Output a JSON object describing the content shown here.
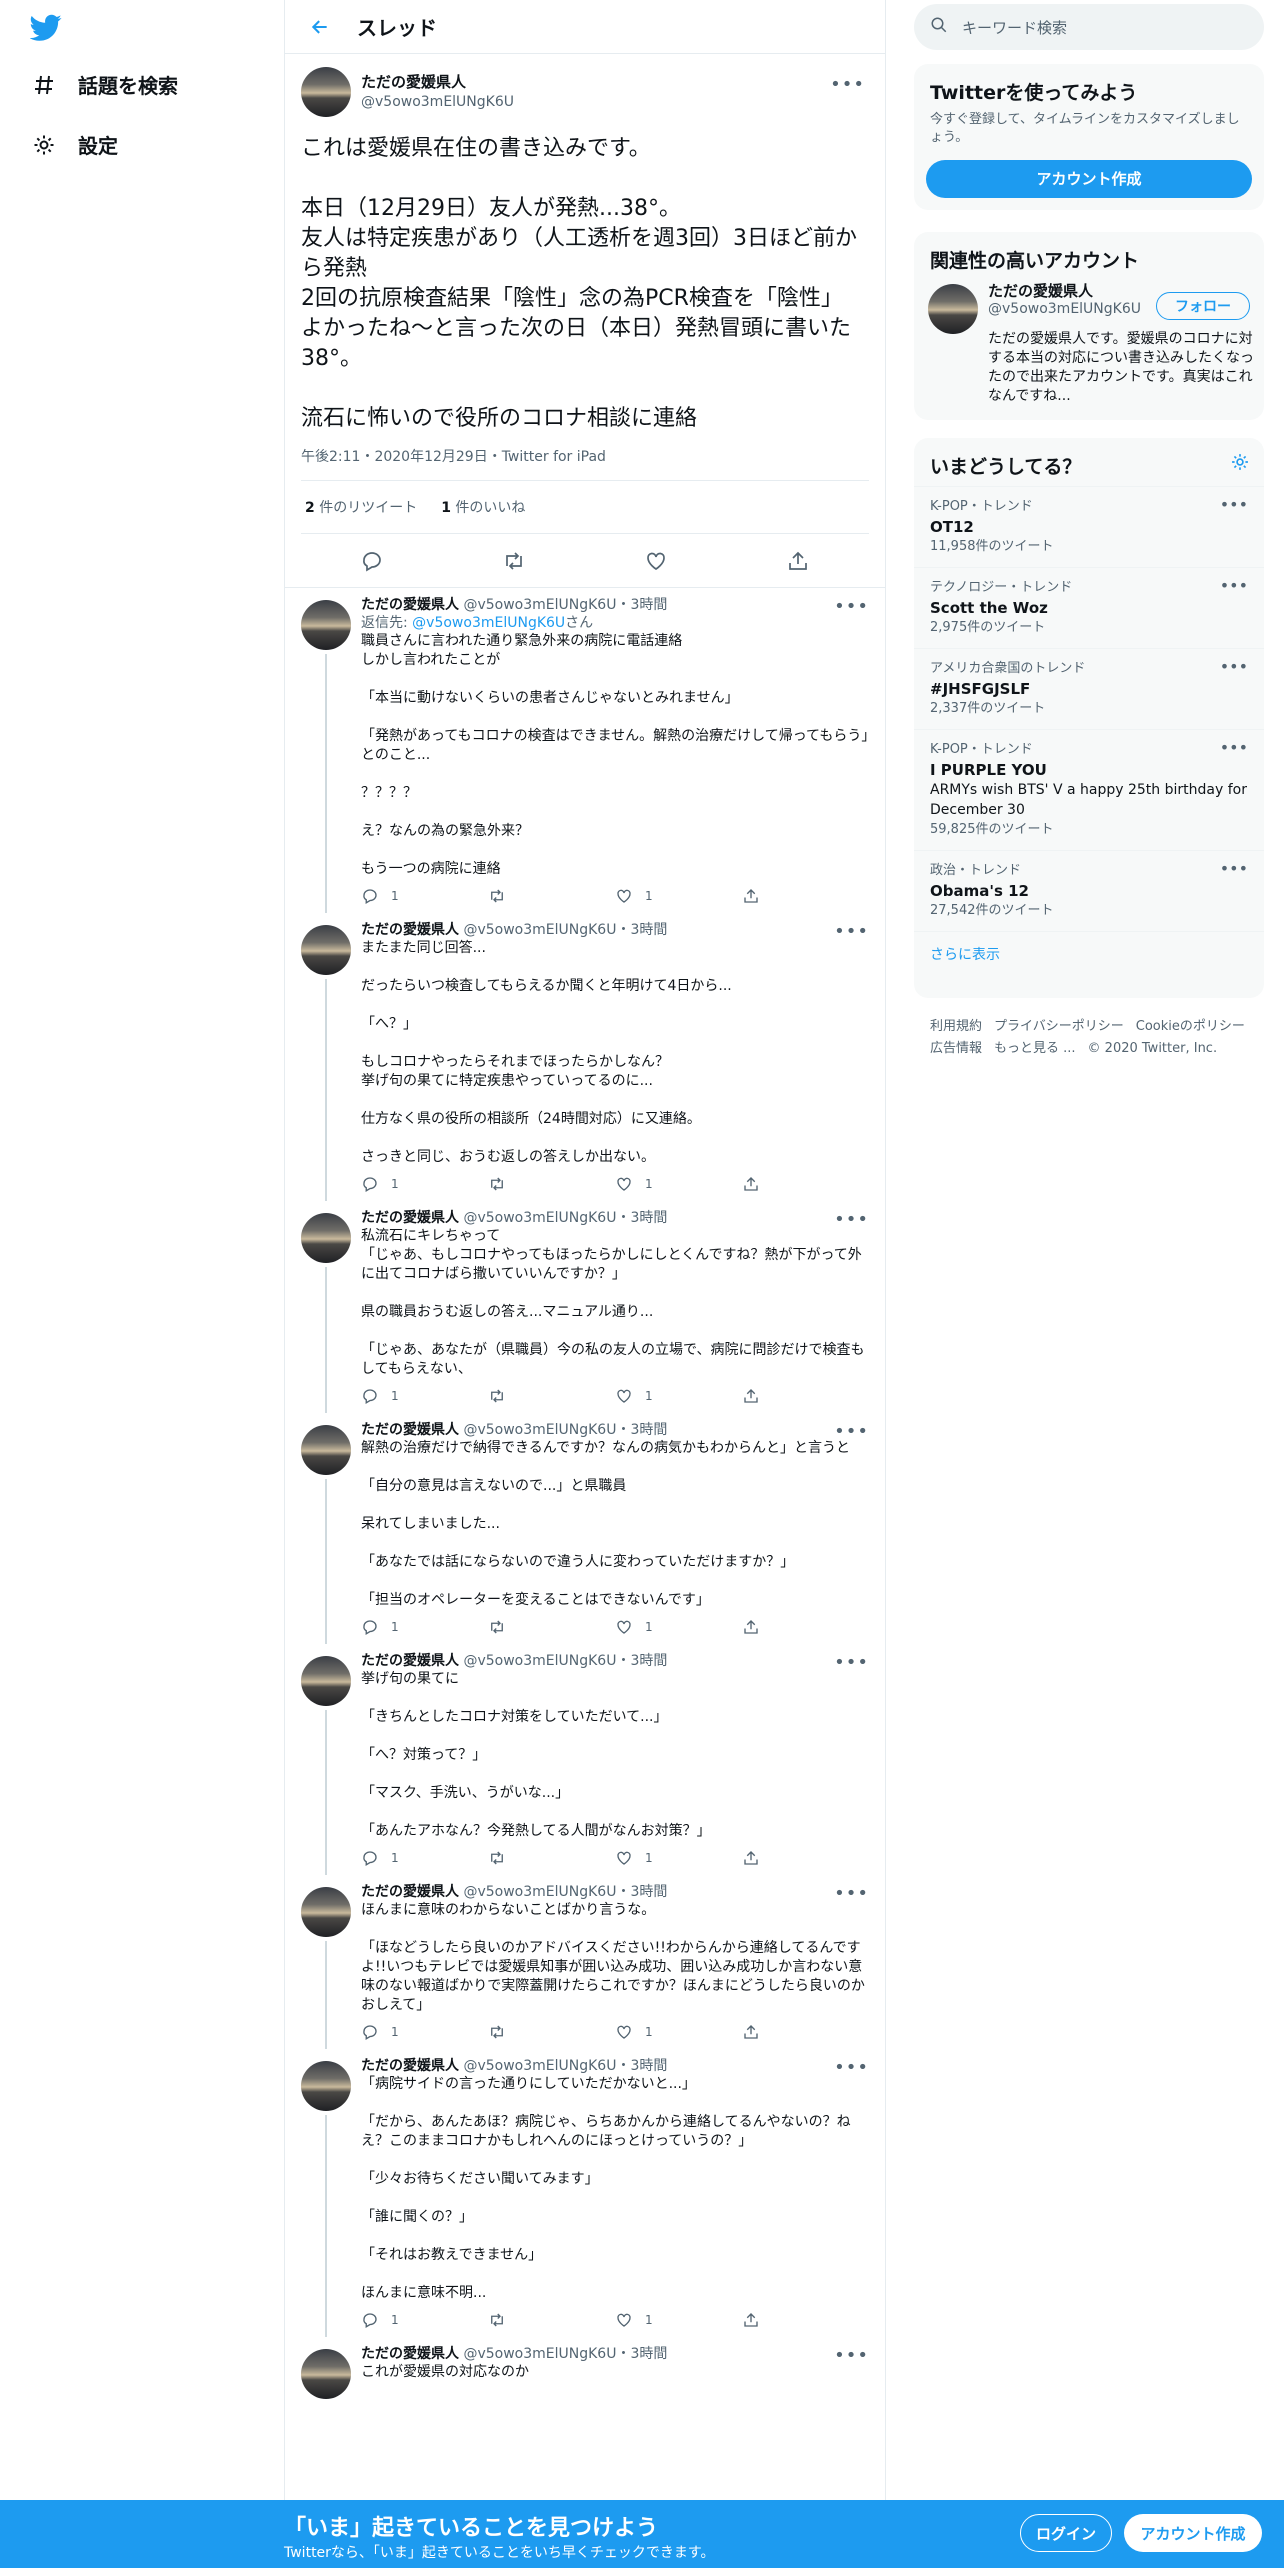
{
  "nav": {
    "explore": "話題を検索",
    "settings": "設定"
  },
  "header": {
    "title": "スレッド"
  },
  "focal": {
    "name": "ただの愛媛県人",
    "handle": "@v5owo3mElUNgK6U",
    "text": "これは愛媛県在住の書き込みです。\n\n本日（12月29日）友人が発熱...38°。\n友人は特定疾患があり（人工透析を週3回）3日ほど前から発熱\n2回の抗原検査結果「陰性」念の為PCR検査を「陰性」\nよかったね〜と言った次の日（本日）発熱冒頭に書いた38°。\n\n流石に怖いので役所のコロナ相談に連絡",
    "meta": "午後2:11・2020年12月29日・Twitter for iPad",
    "retweets": "2",
    "retweets_label": "件のリツイート",
    "likes": "1",
    "likes_label": "件のいいね"
  },
  "replies": [
    {
      "name": "ただの愛媛県人",
      "handle": "@v5owo3mElUNgK6U",
      "time": "・3時間",
      "reply_prefix": "返信先: ",
      "reply_handle": "@v5owo3mElUNgK6U",
      "reply_suffix": "さん",
      "text": "職員さんに言われた通り緊急外来の病院に電話連絡\nしかし言われたことが\n\n「本当に動けないくらいの患者さんじゃないとみれません」\n\n「発熱があってもコロナの検査はできません。解熱の治療だけして帰ってもらう」とのこと...\n\n？？？？\n\nえ？なんの為の緊急外来？\n\nもう一つの病院に連絡",
      "reply_count": "1",
      "like_count": "1"
    },
    {
      "name": "ただの愛媛県人",
      "handle": "@v5owo3mElUNgK6U",
      "time": "・3時間",
      "text": "またまた同じ回答...\n\nだったらいつ検査してもらえるか聞くと年明けて4日から...\n\n「へ？」\n\nもしコロナやったらそれまでほったらかしなん？\n挙げ句の果てに特定疾患やっていってるのに...\n\n仕方なく県の役所の相談所（24時間対応）に又連絡。\n\nさっきと同じ、おうむ返しの答えしか出ない。",
      "reply_count": "1",
      "like_count": "1"
    },
    {
      "name": "ただの愛媛県人",
      "handle": "@v5owo3mElUNgK6U",
      "time": "・3時間",
      "text": "私流石にキレちゃって\n「じゃあ、もしコロナやってもほったらかしにしとくんですね？熱が下がって外に出てコロナばら撒いていいんですか？」\n\n県の職員おうむ返しの答え...マニュアル通り...\n\n「じゃあ、あなたが（県職員）今の私の友人の立場で、病院に問診だけで検査もしてもらえない、",
      "reply_count": "1",
      "like_count": "1"
    },
    {
      "name": "ただの愛媛県人",
      "handle": "@v5owo3mElUNgK6U",
      "time": "・3時間",
      "text": "解熱の治療だけで納得できるんですか？なんの病気かもわからんと」と言うと\n\n「自分の意見は言えないので...」と県職員\n\n呆れてしまいました...\n\n「あなたでは話にならないので違う人に変わっていただけますか？」\n\n「担当のオペレーターを変えることはできないんです」",
      "reply_count": "1",
      "like_count": "1"
    },
    {
      "name": "ただの愛媛県人",
      "handle": "@v5owo3mElUNgK6U",
      "time": "・3時間",
      "text": "挙げ句の果てに\n\n「きちんとしたコロナ対策をしていただいて...」\n\n「へ？対策って？」\n\n「マスク、手洗い、うがいな...」\n\n「あんたアホなん？今発熱してる人間がなんお対策？」",
      "reply_count": "1",
      "like_count": "1"
    },
    {
      "name": "ただの愛媛県人",
      "handle": "@v5owo3mElUNgK6U",
      "time": "・3時間",
      "text": "ほんまに意味のわからないことばかり言うな。\n\n「ほなどうしたら良いのかアドバイスください!!わからんから連絡してるんですよ!!いつもテレビでは愛媛県知事が囲い込み成功、囲い込み成功しか言わない意味のない報道ばかりで実際蓋開けたらこれですか？ほんまにどうしたら良いのかおしえて」",
      "reply_count": "1",
      "like_count": "1"
    },
    {
      "name": "ただの愛媛県人",
      "handle": "@v5owo3mElUNgK6U",
      "time": "・3時間",
      "text": "「病院サイドの言った通りにしていただかないと...」\n\n「だから、あんたあほ？病院じゃ、らちあかんから連絡してるんやないの？ねえ？このままコロナかもしれへんのにほっとけっていうの？」\n\n「少々お待ちください聞いてみます」\n\n「誰に聞くの？」\n\n「それはお教えできません」\n\nほんまに意味不明...",
      "reply_count": "1",
      "like_count": "1"
    },
    {
      "name": "ただの愛媛県人",
      "handle": "@v5owo3mElUNgK6U",
      "time": "・3時間",
      "text": "これが愛媛県の対応なのか",
      "reply_count": "",
      "like_count": ""
    }
  ],
  "sidebar": {
    "search_placeholder": "キーワード検索",
    "signup_card": {
      "title": "Twitterを使ってみよう",
      "desc": "今すぐ登録して、タイムラインをカスタマイズしましょう。",
      "button": "アカウント作成"
    },
    "related": {
      "title": "関連性の高いアカウント",
      "name": "ただの愛媛県人",
      "handle": "@v5owo3mElUNgK6U",
      "follow": "フォロー",
      "bio": "ただの愛媛県人です。愛媛県のコロナに対する本当の対応につい書き込みしたくなったので出来たアカウントです。真実はこれなんですね..."
    },
    "trends": {
      "title": "いまどうしてる？",
      "items": [
        {
          "cat": "K-POP・トレンド",
          "name": "OT12",
          "desc": "",
          "count": "11,958件のツイート"
        },
        {
          "cat": "テクノロジー・トレンド",
          "name": "Scott the Woz",
          "desc": "",
          "count": "2,975件のツイート"
        },
        {
          "cat": "アメリカ合衆国のトレンド",
          "name": "#JHSFGJSLF",
          "desc": "",
          "count": "2,337件のツイート"
        },
        {
          "cat": "K-POP・トレンド",
          "name": "I PURPLE YOU",
          "desc": "ARMYs wish BTS' V a happy 25th birthday for December 30",
          "count": "59,825件のツイート"
        },
        {
          "cat": "政治・トレンド",
          "name": "Obama's 12",
          "desc": "",
          "count": "27,542件のツイート"
        }
      ],
      "show_more": "さらに表示"
    },
    "footer": {
      "terms": "利用規約",
      "privacy": "プライバシーポリシー",
      "cookie": "Cookieのポリシー",
      "ads": "広告情報",
      "more": "もっと見る ...",
      "copyright": "© 2020 Twitter, Inc."
    }
  },
  "bottom_bar": {
    "title": "「いま」起きていることを見つけよう",
    "subtitle": "Twitterなら、「いま」起きていることをいち早くチェックできます。",
    "login": "ログイン",
    "signup": "アカウント作成"
  },
  "colors": {
    "accent": "#1d9bf0",
    "text": "#0f1419",
    "muted": "#536471"
  }
}
